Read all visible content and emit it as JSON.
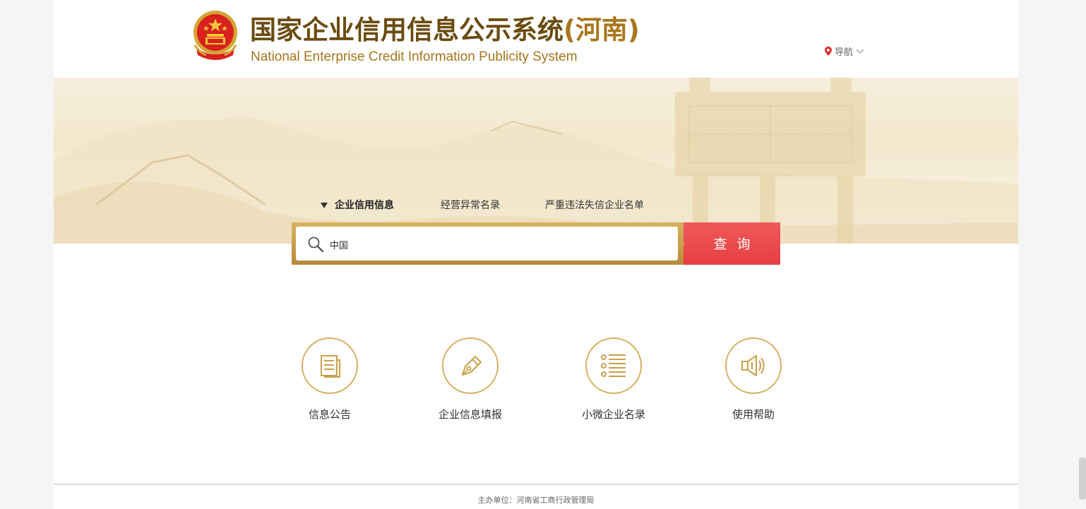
{
  "header": {
    "title_cn": "国家企业信用信息公示系统",
    "title_province": "(河南)",
    "title_en": "National Enterprise Credit Information Publicity System",
    "nav_label": "导航"
  },
  "search": {
    "tabs": [
      {
        "label": "企业信用信息",
        "active": true
      },
      {
        "label": "经营异常名录",
        "active": false
      },
      {
        "label": "严重违法失信企业名单",
        "active": false
      }
    ],
    "value": "中国",
    "button_label": "查询"
  },
  "features": [
    {
      "label": "信息公告",
      "icon": "document-icon"
    },
    {
      "label": "企业信息填报",
      "icon": "pen-icon"
    },
    {
      "label": "小微企业名录",
      "icon": "list-icon"
    },
    {
      "label": "使用帮助",
      "icon": "speaker-icon"
    }
  ],
  "footer": {
    "text": "主办单位：河南省工商行政管理局"
  },
  "colors": {
    "gold": "#d4b15d",
    "brown": "#6b4c10",
    "red_button": "#e94a4c"
  }
}
